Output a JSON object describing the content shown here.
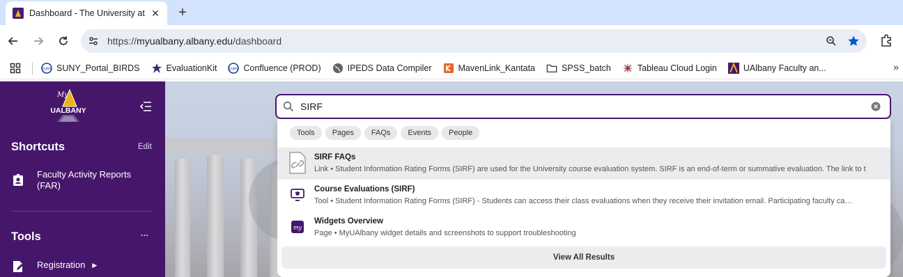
{
  "browser": {
    "tab_title": "Dashboard - The University at Albany",
    "url_protocol": "https://",
    "url_host": "myualbany.albany.edu",
    "url_path": "/dashboard",
    "bookmarks": [
      {
        "label": "SUNY_Portal_BIRDS",
        "icon": "suny-icon"
      },
      {
        "label": "EvaluationKit",
        "icon": "evaluationkit-icon"
      },
      {
        "label": "Confluence (PROD)",
        "icon": "suny-icon"
      },
      {
        "label": "IPEDS Data Compiler",
        "icon": "globe-icon"
      },
      {
        "label": "MavenLink_Kantata",
        "icon": "kantata-icon"
      },
      {
        "label": "SPSS_batch",
        "icon": "folder-icon"
      },
      {
        "label": "Tableau Cloud Login",
        "icon": "tableau-icon"
      },
      {
        "label": "UAlbany Faculty an...",
        "icon": "ualbany-icon"
      }
    ]
  },
  "sidebar": {
    "logo_text_top": "My",
    "logo_text": "UALBANY",
    "shortcuts_title": "Shortcuts",
    "shortcuts_action": "Edit",
    "shortcut_items": [
      {
        "label": "Faculty Activity Reports (FAR)"
      }
    ],
    "tools_title": "Tools",
    "tools_action": "···",
    "tool_items": [
      {
        "label": "Registration"
      }
    ]
  },
  "search": {
    "value": "SIRF",
    "chips": [
      "Tools",
      "Pages",
      "FAQs",
      "Events",
      "People"
    ],
    "results": [
      {
        "title": "SIRF FAQs",
        "type": "Link",
        "desc": "Student Information Rating Forms (SIRF) are used for the University course evaluation system. SIRF is an end-of-term or summative evaluation. The link to t",
        "icon": "document-link-icon"
      },
      {
        "title": "Course Evaluations (SIRF)",
        "type": "Tool",
        "desc": "Student Information Rating Forms (SIRF) - Students can access their class evaluations when they receive their invitation email. Participating faculty ca…",
        "icon": "monitor-graduation-icon"
      },
      {
        "title": "Widgets Overview",
        "type": "Page",
        "desc": "MyUAlbany widget details and screenshots to support troubleshooting",
        "icon": "my-page-icon"
      }
    ],
    "view_all_label": "View All Results"
  },
  "colors": {
    "brand_purple": "#46166b",
    "brand_gold": "#eeb211",
    "tabstrip": "#d3e3fd"
  }
}
